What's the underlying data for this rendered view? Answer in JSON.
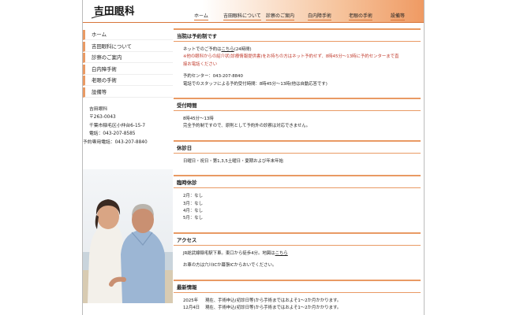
{
  "site": {
    "logo": "吉田眼科"
  },
  "nav": [
    "ホーム",
    "吉田眼科について",
    "診察のご案内",
    "白内障手術",
    "老眼の手術",
    "設備等"
  ],
  "sidebar": [
    "ホーム",
    "吉田眼科について",
    "診察のご案内",
    "白内障手術",
    "老眼の手術",
    "設備等"
  ],
  "address": {
    "name": "吉田眼科",
    "postal": "〒263-0043",
    "street": "千葉市稲毛区小仲台6-15-7",
    "tel": "電話：043-207-8585",
    "reserve_tel": "予約専用電話：043-207-8840"
  },
  "sections": {
    "reservation": {
      "title": "当院は予約制です",
      "l1_a": "ネットでのご予約は",
      "l1_link": "こちら",
      "l1_b": "(24時間)",
      "l2": "※他の眼科からの紹介状(診療情報提供書)をお持ちの方はネット予約せず、8時45分～13時に予約センターまで直",
      "l3": "接お電話ください",
      "l4": "予約センター：043-207-8840",
      "l5": "電話でのスタッフによる予約受付時間：8時45分～13時(他は自動応答です)"
    },
    "hours": {
      "title": "受付時間",
      "l1": "8時45分～13時",
      "l2": "完全予約制ですので、原則として予約外の診察は対応できません。"
    },
    "holidays": {
      "title": "休診日",
      "l1": "日曜日・祝日・第1,3,5土曜日・夏期および年末年始"
    },
    "temp": {
      "title": "臨時休診",
      "months": [
        "2月：なし",
        "3月：なし",
        "4月：なし",
        "5月：なし"
      ]
    },
    "access": {
      "title": "アクセス",
      "l1_a": "JR総武線稲毛駅下車。東口から徒歩4分。地図は",
      "l1_link": "こちら",
      "l2": "お車の方は穴川ICか幕張ICからおいでください。"
    },
    "news": {
      "title": "最新情報",
      "year": "2025年",
      "date": "12月4日",
      "l1": "現在、手術申込(初診日等)から手術まではおよそ1～2か月かかります。",
      "l2": "現在、手術申込(初診日等)から手術まではおよそ1～2か月かかります。"
    }
  }
}
